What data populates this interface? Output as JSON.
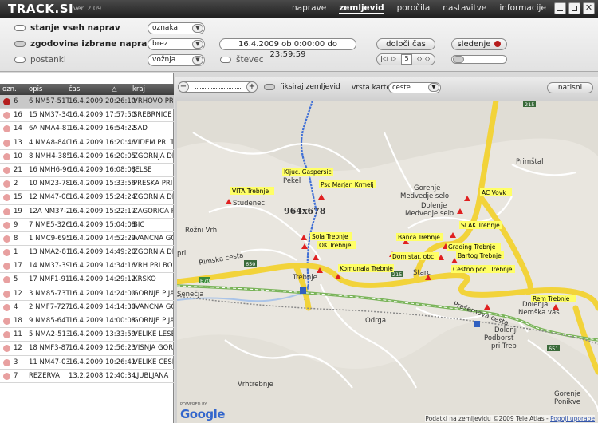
{
  "app": {
    "logo": "TRACK.SI",
    "version": "ver. 2.09"
  },
  "nav": [
    "naprave",
    "zemljevid",
    "poročila",
    "nastavitve",
    "informacije"
  ],
  "controls": {
    "status_all": "stanje vseh naprav",
    "history": "zgodovina izbrane naprave",
    "stops": "postanki",
    "counter": "števec",
    "select_label": "oznaka",
    "select_filter": "brez",
    "select_drive": "vožnja",
    "date_range": "16.4.2009 ob 0:00:00 do 23:59:59",
    "set_time_btn": "določi čas",
    "tracking_btn": "sledenje",
    "player_step": "5"
  },
  "table": {
    "headers": [
      "ozn.",
      "opis",
      "čas",
      "kraj"
    ],
    "rows": [
      {
        "id": "6",
        "desc": "6 NM57-51T",
        "time": "16.4.2009 20:26:10",
        "place": "VRHOVO PRI",
        "selected": true
      },
      {
        "id": "16",
        "desc": "15 NM37-34T",
        "time": "16.4.2009 17:57:50",
        "place": "SREBRNIČE"
      },
      {
        "id": "14",
        "desc": "6A NMA4-81",
        "time": "16.4.2009 16:54:22",
        "place": "SAD"
      },
      {
        "id": "13",
        "desc": "4 NMA8-840",
        "time": "16.4.2009 16:20:46",
        "place": "VIDEM PRI TE"
      },
      {
        "id": "10",
        "desc": "8 NMH4-385",
        "time": "16.4.2009 16:20:05",
        "place": "ZGORNJA DR"
      },
      {
        "id": "21",
        "desc": "16 NMH6-96",
        "time": "16.4.2009 16:08:08",
        "place": "JELŠE"
      },
      {
        "id": "2",
        "desc": "10 NM23-78F",
        "time": "16.4.2009 15:33:56",
        "place": "PRESKA PRI D"
      },
      {
        "id": "15",
        "desc": "12 NM47-08F",
        "time": "16.4.2009 15:24:24",
        "place": "ZGORNJA DR"
      },
      {
        "id": "19",
        "desc": "12A NM37-2",
        "time": "16.4.2009 15:22:17",
        "place": "ZAGORICA PF"
      },
      {
        "id": "9",
        "desc": "7 NME5-326",
        "time": "16.4.2009 15:04:08",
        "place": "BIČ"
      },
      {
        "id": "8",
        "desc": "1 NMC9-695",
        "time": "16.4.2009 14:52:29",
        "place": "IVANČNA GO"
      },
      {
        "id": "1",
        "desc": "13 NMA2-81",
        "time": "16.4.2009 14:49:20",
        "place": "ZGORNJA DR"
      },
      {
        "id": "17",
        "desc": "14 NM37-39",
        "time": "16.4.2009 14:34:16",
        "place": "VRH PRI BOŠ"
      },
      {
        "id": "5",
        "desc": "17 NMF1-91",
        "time": "16.4.2009 14:29:12",
        "place": "KRŠKO"
      },
      {
        "id": "12",
        "desc": "3 NM85-73T",
        "time": "16.4.2009 14:24:00",
        "place": "GORNJE PIJA"
      },
      {
        "id": "4",
        "desc": "2 NMF7-727",
        "time": "16.4.2009 14:14:30",
        "place": "IVANČNA GO"
      },
      {
        "id": "18",
        "desc": "9 NM85-64T",
        "time": "16.4.2009 14:00:08",
        "place": "GORNJE PIJA"
      },
      {
        "id": "11",
        "desc": "5 NMA2-513",
        "time": "16.4.2009 13:33:59",
        "place": "VELIKE LESE"
      },
      {
        "id": "12",
        "desc": "18 NMF3-87",
        "time": "16.4.2009 12:56:23",
        "place": "VIŠNJA GORA"
      },
      {
        "id": "3",
        "desc": "11 NM47-03F",
        "time": "16.4.2009 10:26:41",
        "place": "VELIKE ČEŠN"
      },
      {
        "id": "7",
        "desc": "REZERVA",
        "time": "13.2.2008 12:40:34",
        "place": "LJUBLJANA"
      }
    ]
  },
  "map": {
    "fix_map": "fiksiraj zemljevid",
    "map_type_label": "vrsta karte",
    "map_type": "ceste",
    "print": "natisni",
    "size_overlay": "964x678",
    "copyright": "Podatki na zemljevidu ©2009 Tele Atlas -",
    "terms": "Pogoji uporabe",
    "powered_by": "POWERED BY",
    "google": "Google",
    "places": [
      "Pekel",
      "Studenec",
      "Rožni Vrh",
      "Gorenje Medvedje selo",
      "Dolenje Medvedje selo",
      "Primštal",
      "Trebnje",
      "Senečja",
      "Odrga",
      "Dolenja Nemška vas",
      "Podborst pri Trebnjem",
      "Vrhtrebnje",
      "Gorenje Ponikve",
      "Rimska cesta",
      "Starc",
      "Prešernova cesta",
      "Dolenji pri"
    ],
    "vehicles": [
      "VITA Trebnje",
      "Kljuc. Gaspersic",
      "Psc Marjan Krmelj",
      "AC Vovk",
      "SLAK Trebnje",
      "Sola Trebnje",
      "OK Trebnje",
      "Banca Trebnje",
      "Grading Trebnje",
      "Bartog Trebnje",
      "Dom star. obc",
      "Komunala Trebnje",
      "Cestno pod. Trebnje",
      "Rem Trebnje"
    ],
    "road_numbers": [
      "215",
      "650",
      "215",
      "651",
      "E70"
    ]
  }
}
